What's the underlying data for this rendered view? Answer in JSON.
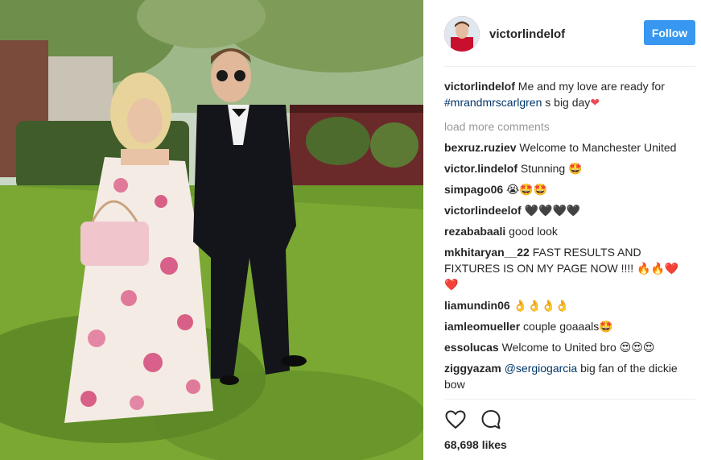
{
  "post": {
    "username": "victorlindelof",
    "follow_label": "Follow",
    "caption_user": "victorlindelof",
    "caption_text_1": "Me and my love are ready for",
    "caption_hashtag": "#mrandmrscarlgren",
    "caption_text_2": "s big day",
    "caption_emoji": "❤",
    "load_more": "load more comments",
    "likes": "68,698 likes"
  },
  "comments": [
    {
      "user": "bexruz.ruziev",
      "text": "Welcome to Manchester United"
    },
    {
      "user": "victor.lindelof",
      "text": "Stunning 🤩"
    },
    {
      "user": "simpago06",
      "text": "😭🤩🤩"
    },
    {
      "user": "victorlindeelof",
      "text": "🖤🖤🖤🖤"
    },
    {
      "user": "rezababaali",
      "text": "good look"
    },
    {
      "user": "mkhitaryan__22",
      "text": "FAST RESULTS AND FIXTURES IS ON MY PAGE NOW !!!! 🔥🔥❤️ ❤️"
    },
    {
      "user": "liamundin06",
      "text": "👌👌👌👌"
    },
    {
      "user": "iamleomueller",
      "text": "couple goaaals🤩"
    },
    {
      "user": "essolucas",
      "text": "Welcome to United bro 😍😍😍"
    },
    {
      "user": "ziggyazam",
      "mention": "@sergiogarcia",
      "text": "big fan of the dickie bow"
    }
  ],
  "icons": {
    "like": "heart-outline-icon",
    "comment": "comment-bubble-icon"
  },
  "colors": {
    "follow_button": "#3897f0",
    "hashtag": "#003569",
    "muted": "#999999",
    "caption_heart": "#ed4956"
  }
}
